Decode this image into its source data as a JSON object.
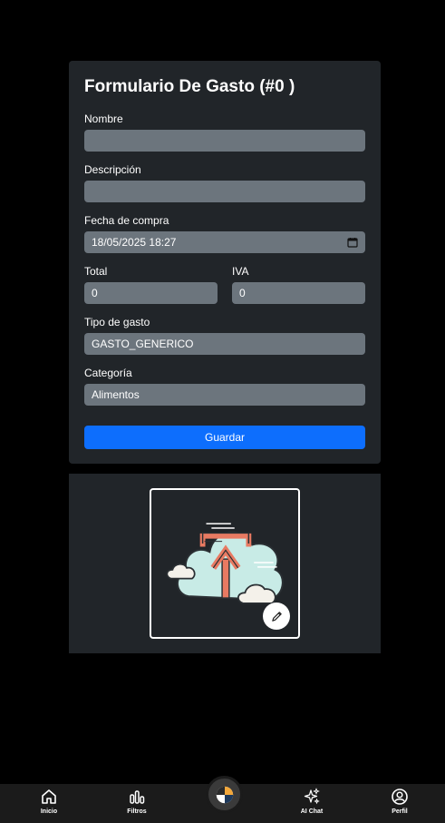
{
  "form": {
    "title": "Formulario De Gasto (#0 )",
    "nombre": {
      "label": "Nombre",
      "value": ""
    },
    "descripcion": {
      "label": "Descripción",
      "value": ""
    },
    "fecha": {
      "label": "Fecha de compra",
      "value": "18/05/2025 18:27"
    },
    "total": {
      "label": "Total",
      "value": "0"
    },
    "iva": {
      "label": "IVA",
      "value": "0"
    },
    "tipo": {
      "label": "Tipo de gasto",
      "value": "GASTO_GENERICO"
    },
    "categoria": {
      "label": "Categoría",
      "value": "Alimentos"
    },
    "save_label": "Guardar"
  },
  "image": {
    "icon": "cloud-upload-illustration",
    "edit_icon": "pencil-icon"
  },
  "nav": {
    "items": [
      {
        "label": "Inicio",
        "icon": "home-icon"
      },
      {
        "label": "Filtros",
        "icon": "chart-bars-icon"
      },
      {
        "label": "",
        "icon": "app-logo-icon"
      },
      {
        "label": "AI Chat",
        "icon": "sparkles-icon"
      },
      {
        "label": "Perfil",
        "icon": "user-circle-icon"
      }
    ]
  },
  "colors": {
    "background": "#000000",
    "card": "#212529",
    "input": "#6c757d",
    "primary": "#0d6efd",
    "nav": "#1b1b1b"
  }
}
